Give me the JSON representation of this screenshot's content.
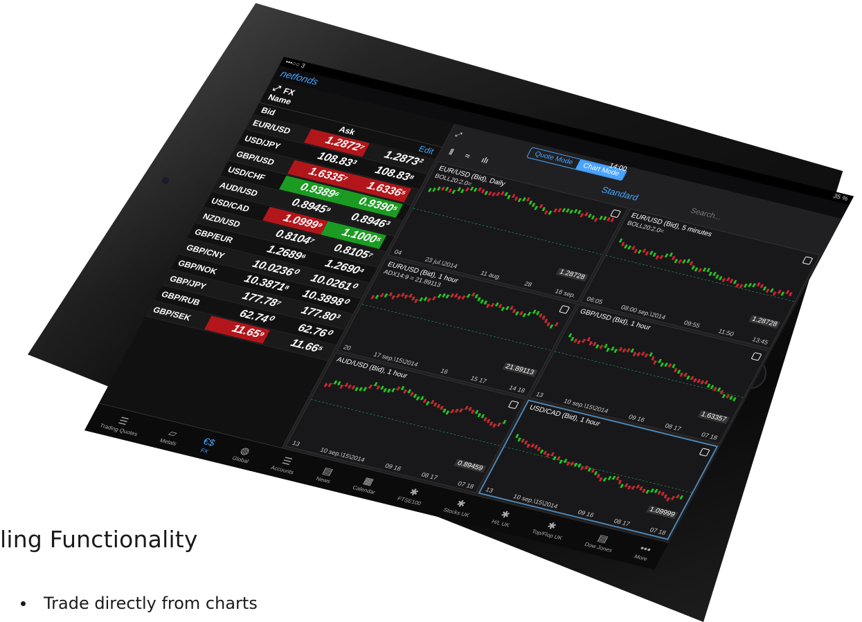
{
  "heading": "ling Functionality",
  "bullets": [
    "Trade directly from charts"
  ],
  "status": {
    "carrier": "•••○○ 3",
    "time": "14:00",
    "battery": "35 %"
  },
  "app": {
    "logo": "netfonds"
  },
  "quotes": {
    "section": "FX",
    "name_header": "Name",
    "bid_header": "Bid",
    "ask_header": "Ask",
    "edit_label": "Edit",
    "rows": [
      {
        "pair": "EUR/USD",
        "bid": "1.2872⁷",
        "ask": "1.2873²",
        "bid_color": "red",
        "ask_color": ""
      },
      {
        "pair": "USD/JPY",
        "bid": "108.83³",
        "ask": "108.83⁸",
        "bid_color": "",
        "ask_color": ""
      },
      {
        "pair": "GBP/USD",
        "bid": "1.6335⁷",
        "ask": "1.6336⁵",
        "bid_color": "red",
        "ask_color": "red"
      },
      {
        "pair": "USD/CHF",
        "bid": "0.9389⁶",
        "ask": "0.9390⁵",
        "bid_color": "green",
        "ask_color": "green"
      },
      {
        "pair": "AUD/USD",
        "bid": "0.8945⁹",
        "ask": "0.8946³",
        "bid_color": "",
        "ask_color": ""
      },
      {
        "pair": "USD/CAD",
        "bid": "1.0999⁹",
        "ask": "1.1000⁵",
        "bid_color": "red",
        "ask_color": "green"
      },
      {
        "pair": "NZD/USD",
        "bid": "0.8104⁷",
        "ask": "0.8105⁷",
        "bid_color": "",
        "ask_color": ""
      },
      {
        "pair": "GBP/EUR",
        "bid": "1.2689⁶",
        "ask": "1.2690⁴",
        "bid_color": "",
        "ask_color": ""
      },
      {
        "pair": "GBP/CNY",
        "bid": "10.0236⁰",
        "ask": "10.0261⁰",
        "bid_color": "",
        "ask_color": ""
      },
      {
        "pair": "GBP/NOK",
        "bid": "10.3871⁸",
        "ask": "10.3898⁰",
        "bid_color": "",
        "ask_color": ""
      },
      {
        "pair": "GBP/JPY",
        "bid": "177.78⁷",
        "ask": "177.80³",
        "bid_color": "",
        "ask_color": ""
      },
      {
        "pair": "GBP/RUB",
        "bid": "62.74⁰",
        "ask": "62.76⁰",
        "bid_color": "",
        "ask_color": ""
      },
      {
        "pair": "GBP/SEK",
        "bid": "11.65⁹",
        "ask": "11.66⁵",
        "bid_color": "red",
        "ask_color": ""
      }
    ]
  },
  "charts": {
    "mode_quote": "Quote Mode",
    "mode_chart": "Chart Mode",
    "layout": "Standard",
    "search_placeholder": "Search...",
    "panels": [
      {
        "title": "EUR/USD (Bid), Daily",
        "sub": "BOLL20:2.0=",
        "last": "1.28728",
        "ticks": [
          "04",
          "23 jul.\\2014",
          "11 aug.",
          "28",
          "16 sep."
        ],
        "color": "#d23"
      },
      {
        "title": "EUR/USD (Bid), 5 minutes",
        "sub": "BOLL20:2.0=",
        "last": "1.28728",
        "ticks": [
          "06:05",
          "08:00 sep.\\2014",
          "09:55",
          "11:50",
          "13:45"
        ],
        "color": "#d23"
      },
      {
        "title": "EUR/USD (Bid), 1 hour",
        "sub": "ADX14:9 = 21.89113",
        "last": "21.89113",
        "ticks": [
          "20",
          "17 sep.\\15\\2014",
          "16",
          "15 17",
          "14 18"
        ],
        "color": "#2c2"
      },
      {
        "title": "GBP/USD (Bid), 1 hour",
        "sub": "",
        "last": "1.63357",
        "ticks": [
          "13",
          "10 sep.\\15\\2014",
          "09 16",
          "08 17",
          "07 18"
        ],
        "color": "#2c2"
      },
      {
        "title": "AUD/USD (Bid), 1 hour",
        "sub": "",
        "last": "0.89459",
        "ticks": [
          "13",
          "10 sep.\\15\\2014",
          "09 16",
          "08 17",
          "07 18"
        ],
        "color": "#2c2"
      },
      {
        "title": "USD/CAD (Bid), 1 hour",
        "sub": "",
        "last": "1.09999",
        "ticks": [
          "13",
          "10 sep.\\15\\2014",
          "09 16",
          "08 17",
          "07 18"
        ],
        "color": "#2c2"
      }
    ]
  },
  "tabs": [
    {
      "label": "Trading Quotes",
      "icon": "list-icon",
      "glyph": "☰"
    },
    {
      "label": "Metals",
      "icon": "bar-icon",
      "glyph": "▱"
    },
    {
      "label": "FX",
      "icon": "currency-icon",
      "glyph": "€$"
    },
    {
      "label": "Global",
      "icon": "globe-icon",
      "glyph": "◍"
    },
    {
      "label": "Accounts",
      "icon": "list-icon",
      "glyph": "☰"
    },
    {
      "label": "News",
      "icon": "news-icon",
      "glyph": "▤"
    },
    {
      "label": "Calendar",
      "icon": "calendar-icon",
      "glyph": "▦"
    },
    {
      "label": "FTSE100",
      "icon": "uk-flag-icon",
      "glyph": "✱"
    },
    {
      "label": "Stocks UK",
      "icon": "uk-flag-icon",
      "glyph": "✱"
    },
    {
      "label": "H/L UK",
      "icon": "uk-flag-icon",
      "glyph": "✱"
    },
    {
      "label": "Top/Flop UK",
      "icon": "uk-flag-icon",
      "glyph": "✱"
    },
    {
      "label": "Dow Jones",
      "icon": "us-flag-icon",
      "glyph": "▤"
    },
    {
      "label": "More",
      "icon": "more-icon",
      "glyph": "•••"
    }
  ],
  "colors": {
    "accent": "#4aa4ff",
    "up": "#1c9b23",
    "down": "#b3161a"
  }
}
